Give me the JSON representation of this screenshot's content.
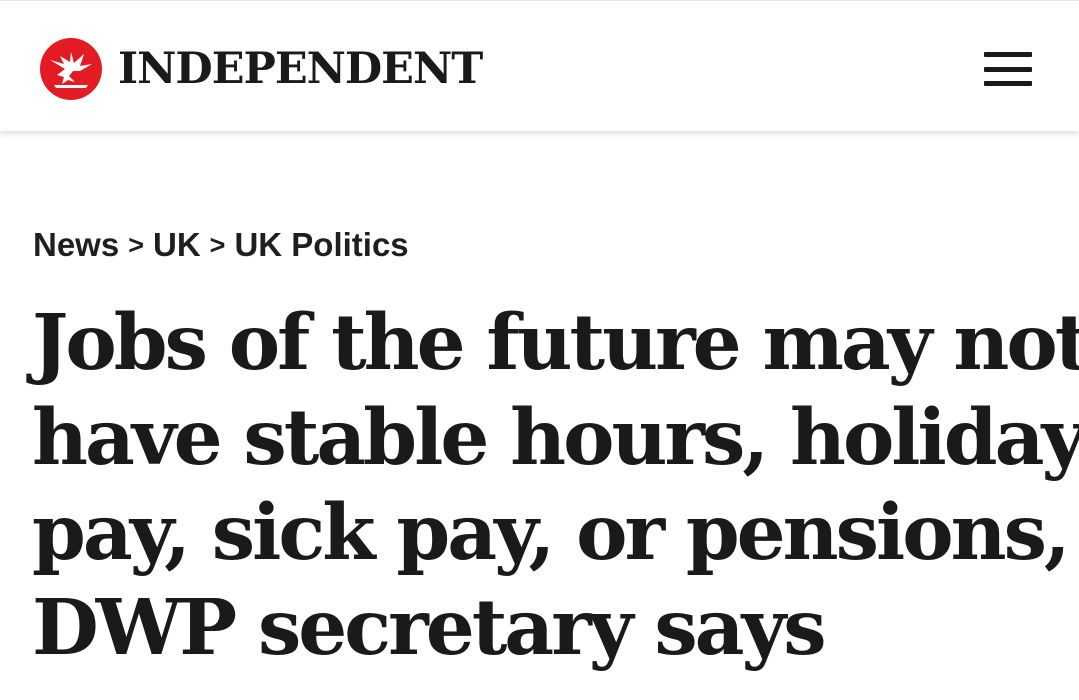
{
  "header": {
    "brand_name": "INDEPENDENT",
    "logo_icon": "eagle-logo-icon",
    "menu_icon": "hamburger-menu-icon",
    "brand_color": "#e31b23"
  },
  "breadcrumb": {
    "items": [
      "News",
      "UK",
      "UK Politics"
    ],
    "separator": ">"
  },
  "article": {
    "headline_lines": [
      "Jobs of the future may not",
      "have stable hours, holiday",
      "pay, sick pay, or pensions,",
      "DWP secretary says"
    ]
  }
}
